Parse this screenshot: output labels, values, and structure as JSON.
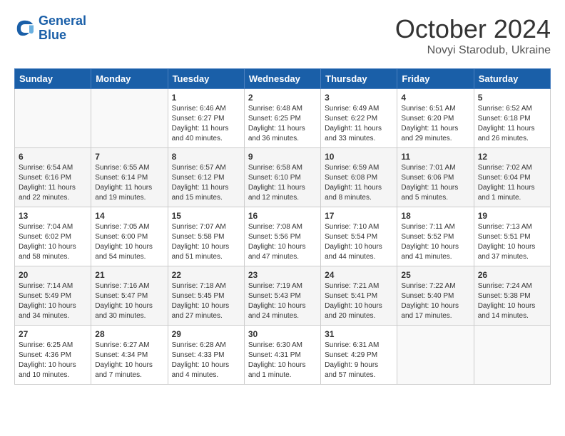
{
  "logo": {
    "line1": "General",
    "line2": "Blue"
  },
  "title": "October 2024",
  "subtitle": "Novyi Starodub, Ukraine",
  "headers": [
    "Sunday",
    "Monday",
    "Tuesday",
    "Wednesday",
    "Thursday",
    "Friday",
    "Saturday"
  ],
  "weeks": [
    [
      {
        "num": "",
        "info": ""
      },
      {
        "num": "",
        "info": ""
      },
      {
        "num": "1",
        "info": "Sunrise: 6:46 AM\nSunset: 6:27 PM\nDaylight: 11 hours\nand 40 minutes."
      },
      {
        "num": "2",
        "info": "Sunrise: 6:48 AM\nSunset: 6:25 PM\nDaylight: 11 hours\nand 36 minutes."
      },
      {
        "num": "3",
        "info": "Sunrise: 6:49 AM\nSunset: 6:22 PM\nDaylight: 11 hours\nand 33 minutes."
      },
      {
        "num": "4",
        "info": "Sunrise: 6:51 AM\nSunset: 6:20 PM\nDaylight: 11 hours\nand 29 minutes."
      },
      {
        "num": "5",
        "info": "Sunrise: 6:52 AM\nSunset: 6:18 PM\nDaylight: 11 hours\nand 26 minutes."
      }
    ],
    [
      {
        "num": "6",
        "info": "Sunrise: 6:54 AM\nSunset: 6:16 PM\nDaylight: 11 hours\nand 22 minutes."
      },
      {
        "num": "7",
        "info": "Sunrise: 6:55 AM\nSunset: 6:14 PM\nDaylight: 11 hours\nand 19 minutes."
      },
      {
        "num": "8",
        "info": "Sunrise: 6:57 AM\nSunset: 6:12 PM\nDaylight: 11 hours\nand 15 minutes."
      },
      {
        "num": "9",
        "info": "Sunrise: 6:58 AM\nSunset: 6:10 PM\nDaylight: 11 hours\nand 12 minutes."
      },
      {
        "num": "10",
        "info": "Sunrise: 6:59 AM\nSunset: 6:08 PM\nDaylight: 11 hours\nand 8 minutes."
      },
      {
        "num": "11",
        "info": "Sunrise: 7:01 AM\nSunset: 6:06 PM\nDaylight: 11 hours\nand 5 minutes."
      },
      {
        "num": "12",
        "info": "Sunrise: 7:02 AM\nSunset: 6:04 PM\nDaylight: 11 hours\nand 1 minute."
      }
    ],
    [
      {
        "num": "13",
        "info": "Sunrise: 7:04 AM\nSunset: 6:02 PM\nDaylight: 10 hours\nand 58 minutes."
      },
      {
        "num": "14",
        "info": "Sunrise: 7:05 AM\nSunset: 6:00 PM\nDaylight: 10 hours\nand 54 minutes."
      },
      {
        "num": "15",
        "info": "Sunrise: 7:07 AM\nSunset: 5:58 PM\nDaylight: 10 hours\nand 51 minutes."
      },
      {
        "num": "16",
        "info": "Sunrise: 7:08 AM\nSunset: 5:56 PM\nDaylight: 10 hours\nand 47 minutes."
      },
      {
        "num": "17",
        "info": "Sunrise: 7:10 AM\nSunset: 5:54 PM\nDaylight: 10 hours\nand 44 minutes."
      },
      {
        "num": "18",
        "info": "Sunrise: 7:11 AM\nSunset: 5:52 PM\nDaylight: 10 hours\nand 41 minutes."
      },
      {
        "num": "19",
        "info": "Sunrise: 7:13 AM\nSunset: 5:51 PM\nDaylight: 10 hours\nand 37 minutes."
      }
    ],
    [
      {
        "num": "20",
        "info": "Sunrise: 7:14 AM\nSunset: 5:49 PM\nDaylight: 10 hours\nand 34 minutes."
      },
      {
        "num": "21",
        "info": "Sunrise: 7:16 AM\nSunset: 5:47 PM\nDaylight: 10 hours\nand 30 minutes."
      },
      {
        "num": "22",
        "info": "Sunrise: 7:18 AM\nSunset: 5:45 PM\nDaylight: 10 hours\nand 27 minutes."
      },
      {
        "num": "23",
        "info": "Sunrise: 7:19 AM\nSunset: 5:43 PM\nDaylight: 10 hours\nand 24 minutes."
      },
      {
        "num": "24",
        "info": "Sunrise: 7:21 AM\nSunset: 5:41 PM\nDaylight: 10 hours\nand 20 minutes."
      },
      {
        "num": "25",
        "info": "Sunrise: 7:22 AM\nSunset: 5:40 PM\nDaylight: 10 hours\nand 17 minutes."
      },
      {
        "num": "26",
        "info": "Sunrise: 7:24 AM\nSunset: 5:38 PM\nDaylight: 10 hours\nand 14 minutes."
      }
    ],
    [
      {
        "num": "27",
        "info": "Sunrise: 6:25 AM\nSunset: 4:36 PM\nDaylight: 10 hours\nand 10 minutes."
      },
      {
        "num": "28",
        "info": "Sunrise: 6:27 AM\nSunset: 4:34 PM\nDaylight: 10 hours\nand 7 minutes."
      },
      {
        "num": "29",
        "info": "Sunrise: 6:28 AM\nSunset: 4:33 PM\nDaylight: 10 hours\nand 4 minutes."
      },
      {
        "num": "30",
        "info": "Sunrise: 6:30 AM\nSunset: 4:31 PM\nDaylight: 10 hours\nand 1 minute."
      },
      {
        "num": "31",
        "info": "Sunrise: 6:31 AM\nSunset: 4:29 PM\nDaylight: 9 hours\nand 57 minutes."
      },
      {
        "num": "",
        "info": ""
      },
      {
        "num": "",
        "info": ""
      }
    ]
  ]
}
